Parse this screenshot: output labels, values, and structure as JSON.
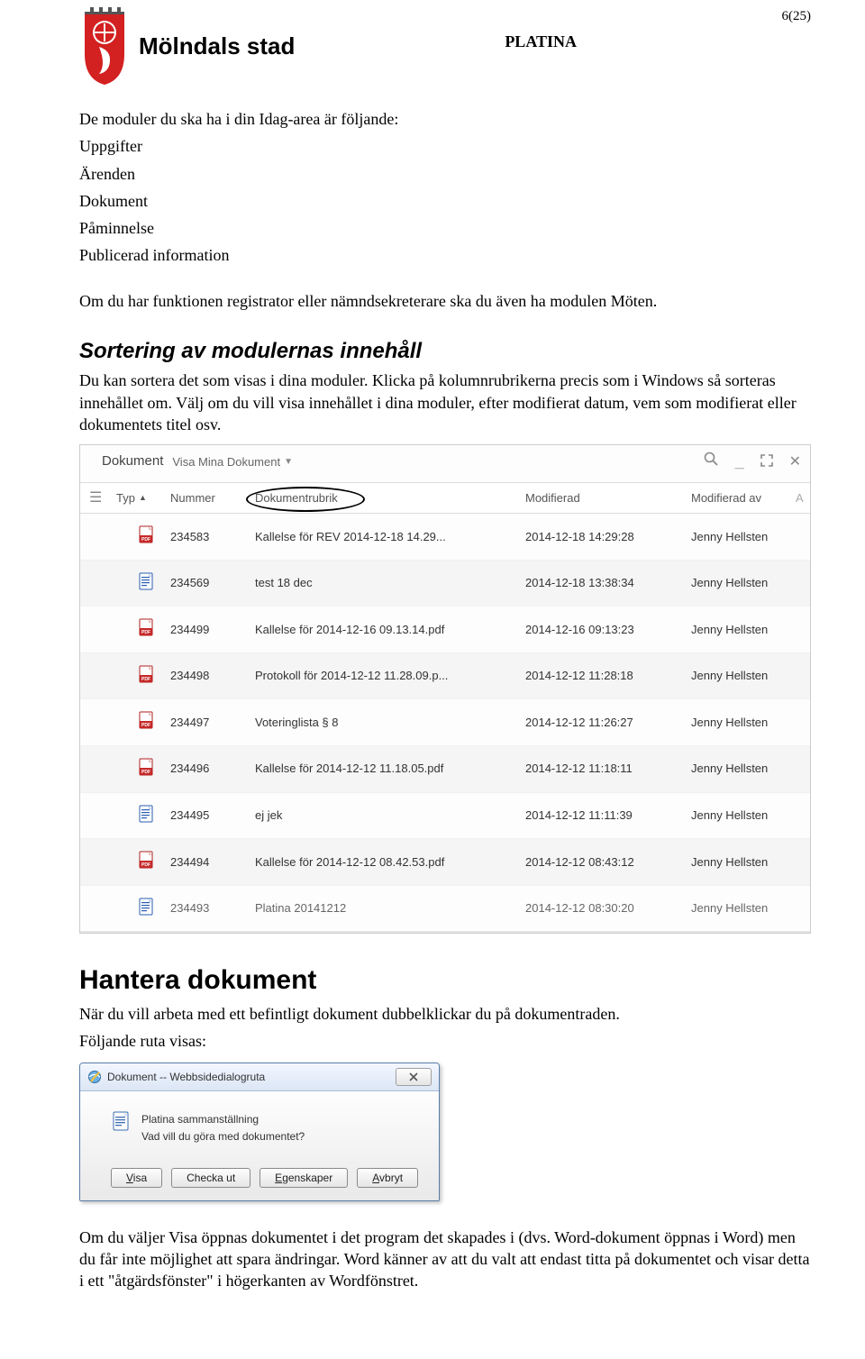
{
  "header": {
    "logo_text": "Mölndals stad",
    "center_title": "PLATINA",
    "page_number": "6(25)"
  },
  "intro": {
    "lead": "De moduler du ska ha i din Idag-area är följande:",
    "modules": [
      "Uppgifter",
      "Ärenden",
      "Dokument",
      "Påminnelse",
      "Publicerad information"
    ],
    "note": "Om du har funktionen registrator eller nämndsekreterare ska du även ha modulen Möten."
  },
  "section_sort": {
    "heading": "Sortering av modulernas innehåll",
    "body": "Du kan sortera det som visas i dina moduler. Klicka på kolumnrubrikerna precis som i Windows så sorteras innehållet om. Välj om du vill visa innehållet i dina moduler, efter modifierat datum, vem som modifierat eller dokumentets titel osv."
  },
  "panel": {
    "title": "Dokument",
    "subtitle": "Visa Mina Dokument",
    "columns": {
      "typ": "Typ",
      "nummer": "Nummer",
      "rubrik": "Dokumentrubrik",
      "modifierad": "Modifierad",
      "modifierad_av": "Modifierad av"
    },
    "rows": [
      {
        "type": "pdf",
        "nummer": "234583",
        "rubrik": "Kallelse för REV 2014-12-18 14.29...",
        "modifierad": "2014-12-18 14:29:28",
        "av": "Jenny Hellsten",
        "alt": false
      },
      {
        "type": "doc",
        "nummer": "234569",
        "rubrik": "test 18 dec",
        "modifierad": "2014-12-18 13:38:34",
        "av": "Jenny Hellsten",
        "alt": true
      },
      {
        "type": "pdf",
        "nummer": "234499",
        "rubrik": "Kallelse för 2014-12-16 09.13.14.pdf",
        "modifierad": "2014-12-16 09:13:23",
        "av": "Jenny Hellsten",
        "alt": false
      },
      {
        "type": "pdf",
        "nummer": "234498",
        "rubrik": "Protokoll för 2014-12-12 11.28.09.p...",
        "modifierad": "2014-12-12 11:28:18",
        "av": "Jenny Hellsten",
        "alt": true
      },
      {
        "type": "pdf",
        "nummer": "234497",
        "rubrik": "Voteringlista § 8",
        "modifierad": "2014-12-12 11:26:27",
        "av": "Jenny Hellsten",
        "alt": false
      },
      {
        "type": "pdf",
        "nummer": "234496",
        "rubrik": "Kallelse för 2014-12-12 11.18.05.pdf",
        "modifierad": "2014-12-12 11:18:11",
        "av": "Jenny Hellsten",
        "alt": true
      },
      {
        "type": "doc",
        "nummer": "234495",
        "rubrik": "ej jek",
        "modifierad": "2014-12-12 11:11:39",
        "av": "Jenny Hellsten",
        "alt": false
      },
      {
        "type": "pdf",
        "nummer": "234494",
        "rubrik": "Kallelse för 2014-12-12 08.42.53.pdf",
        "modifierad": "2014-12-12 08:43:12",
        "av": "Jenny Hellsten",
        "alt": true
      },
      {
        "type": "doc",
        "nummer": "234493",
        "rubrik": "Platina 20141212",
        "modifierad": "2014-12-12 08:30:20",
        "av": "Jenny Hellsten",
        "alt": false,
        "last": true
      }
    ],
    "side_label": "A"
  },
  "section_hantera": {
    "heading": "Hantera dokument",
    "p1": "När du vill arbeta med ett befintligt dokument dubbelklickar du på dokumentraden.",
    "p2": "Följande ruta visas:"
  },
  "dialog": {
    "title": "Dokument -- Webbsidedialogruta",
    "line1": "Platina sammanställning",
    "line2": "Vad vill du göra med dokumentet?",
    "buttons": {
      "visa": "Visa",
      "checka": "Checka ut",
      "egenskaper": "Egenskaper",
      "avbryt": "Avbryt"
    }
  },
  "trailing": "Om du väljer Visa öppnas dokumentet i det program det skapades i (dvs. Word-dokument öppnas i Word) men du får inte möjlighet att spara ändringar. Word känner av att du valt att endast titta på dokumentet och visar detta i ett \"åtgärdsfönster\" i högerkanten av Wordfönstret."
}
